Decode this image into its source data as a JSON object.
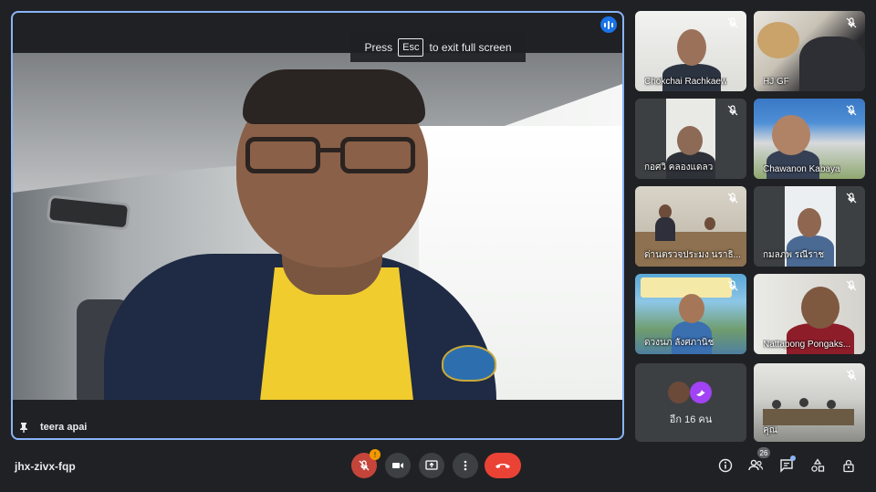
{
  "toast": {
    "press": "Press",
    "key": "Esc",
    "rest": "to exit full screen"
  },
  "main": {
    "speaker_name": "teera apai"
  },
  "tiles": [
    {
      "name": "Chokchai Rachkaew"
    },
    {
      "name": "HJ GF"
    },
    {
      "name": "กอศวิ คลองแดลว"
    },
    {
      "name": "Chawanon Kabaya"
    },
    {
      "name": "ด่านตรวจประมง นราธิ..."
    },
    {
      "name": "กมลภพ รณีราช"
    },
    {
      "name": "ดวงนภ ลังศภานิช"
    },
    {
      "name": "Nattapong Pongaks..."
    },
    {
      "name": "คุณ"
    }
  ],
  "more_tile": {
    "label": "อีก 16 คน"
  },
  "bottom": {
    "meeting_code": "jhx-zivx-fqp",
    "mic_badge": "!",
    "participant_count": "26"
  },
  "colors": {
    "accent": "#8ab4f8",
    "danger": "#ea4335",
    "background": "#202124"
  }
}
